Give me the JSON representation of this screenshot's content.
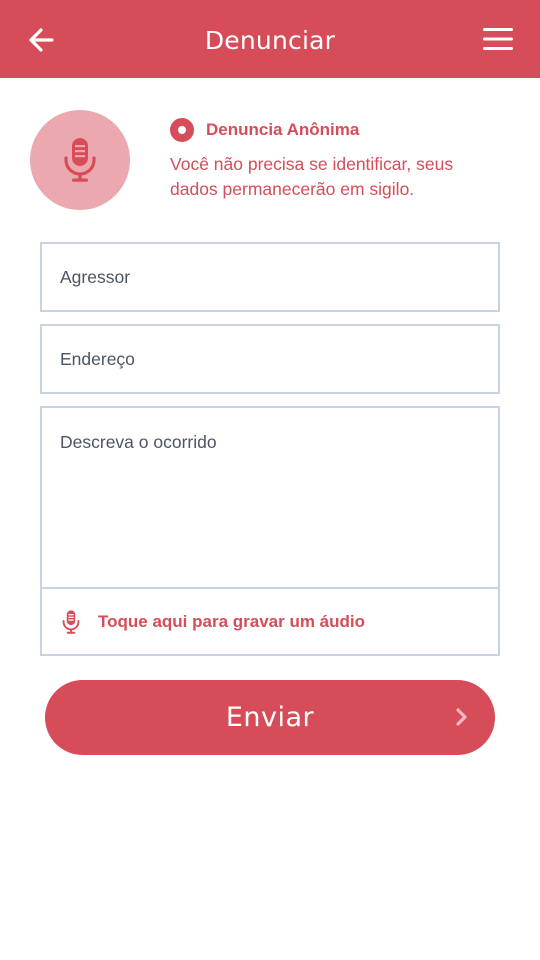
{
  "header": {
    "title": "Denunciar",
    "background_color": "#d64d59",
    "back_icon": "arrow-left-icon",
    "menu_icon": "hamburger-menu-icon"
  },
  "anonymous": {
    "label": "Denuncia Anônima",
    "selected": true,
    "description": "Você não precisa se identificar, seus dados permanecerão em sigilo.",
    "mic_icon": "microphone-icon",
    "mic_circle_color": "#eba8ae"
  },
  "form": {
    "agressor_placeholder": "Agressor",
    "agressor_value": "",
    "endereco_placeholder": "Endereço",
    "endereco_value": "",
    "descricao_placeholder": "Descreva o ocorrido",
    "descricao_value": "",
    "audio_label": "Toque aqui para gravar um áudio",
    "audio_icon": "microphone-icon"
  },
  "submit": {
    "label": "Enviar",
    "icon": "chevron-right-icon"
  }
}
